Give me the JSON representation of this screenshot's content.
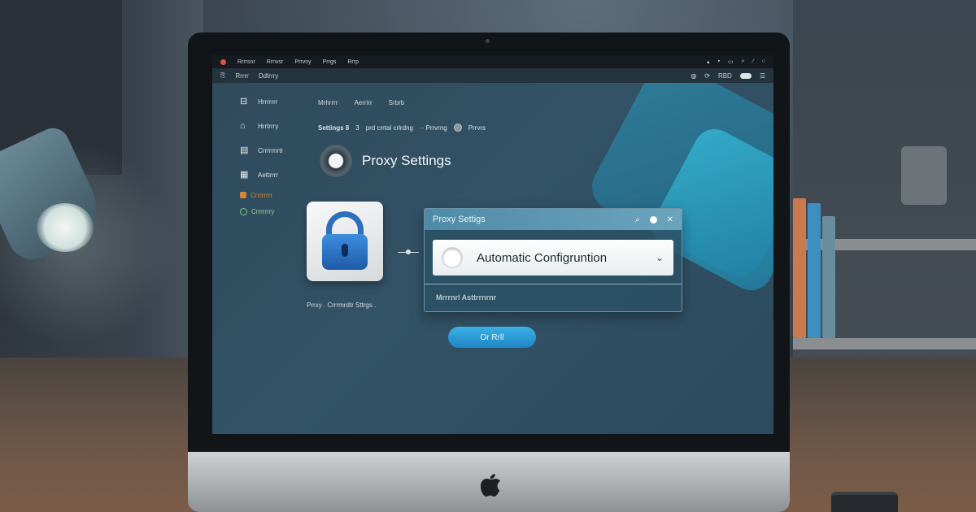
{
  "menubar": {
    "items": [
      "Rrrrsnr",
      "Rrnvsr",
      "Prrvny",
      "Prrgs",
      "Rrrp"
    ],
    "tray_icons": [
      "wifi-icon",
      "bluetooth-icon",
      "battery-icon",
      "search-icon",
      "control-center-icon",
      "clock-icon"
    ]
  },
  "toolbar": {
    "items": [
      "Rrrrr",
      "Ddtrrry"
    ],
    "right_icons": [
      "sync-icon",
      "refresh-icon",
      "fbd-icon",
      "toggle-icon",
      "menu-icon"
    ],
    "right_text": "RBD"
  },
  "sidebar": {
    "items": [
      {
        "label": "Hrrrrrrr",
        "icon": "network-icon"
      },
      {
        "label": "Hrrtrrry",
        "icon": "home-icon"
      },
      {
        "label": "Crrrrrnrtr",
        "icon": "folder-icon"
      },
      {
        "label": "Aettrrrr",
        "icon": "document-icon"
      }
    ],
    "extra": [
      {
        "label": "Crrrrrrrr",
        "color": "#d5883a"
      },
      {
        "label": "Crrrrrrry",
        "color": "#6fd07c"
      }
    ]
  },
  "tabs": [
    "Mrhrrrr",
    "Aerrirr",
    "Srbrb"
  ],
  "breadcrumb": {
    "part1": "Settings 8",
    "part2": "3",
    "part3": "prd crrtal crlrdng",
    "part4": "·· Prrvrng",
    "part5": "Prrvrs"
  },
  "page_title": "Proxy Settings",
  "lock_caption": "Prrxy . Crrrmrdtr Sttrgs .",
  "dialog": {
    "title": "Proxy Settigs",
    "selected_option": "Automatic Configruntion",
    "secondary_option": "Mrrrnrl Asttrrnrnr",
    "ok_label": "Or Rrll"
  },
  "colors": {
    "accent": "#1e86c4",
    "lock_blue": "#2d6fb8",
    "dialog_header": "#5a96b2"
  }
}
